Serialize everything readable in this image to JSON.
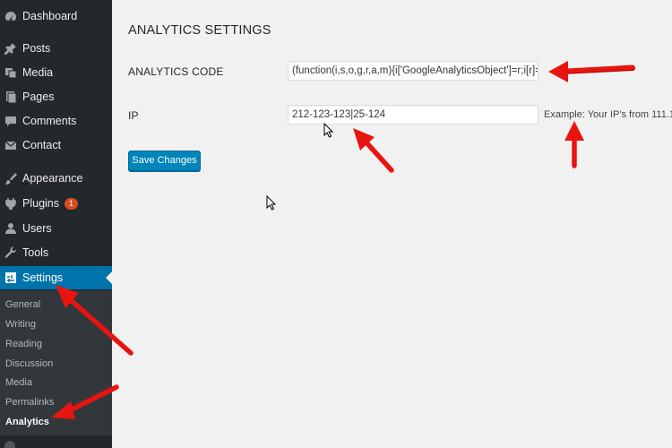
{
  "sidebar": {
    "items": [
      {
        "label": "Dashboard",
        "icon": "dashboard-icon"
      },
      {
        "label": "Posts",
        "icon": "pin-icon"
      },
      {
        "label": "Media",
        "icon": "media-icon"
      },
      {
        "label": "Pages",
        "icon": "pages-icon"
      },
      {
        "label": "Comments",
        "icon": "comment-icon"
      },
      {
        "label": "Contact",
        "icon": "mail-icon"
      },
      {
        "label": "Appearance",
        "icon": "brush-icon"
      },
      {
        "label": "Plugins",
        "icon": "plug-icon",
        "badge": "1"
      },
      {
        "label": "Users",
        "icon": "user-icon"
      },
      {
        "label": "Tools",
        "icon": "wrench-icon"
      },
      {
        "label": "Settings",
        "icon": "settings-icon"
      }
    ],
    "submenu": [
      "General",
      "Writing",
      "Reading",
      "Discussion",
      "Media",
      "Permalinks",
      "Analytics"
    ]
  },
  "main": {
    "title": "ANALYTICS SETTINGS",
    "analytics_code_label": "ANALYTICS CODE",
    "analytics_code_value": "(function(i,s,o,g,r,a,m){i['GoogleAnalyticsObject']=r;i[r]=",
    "ip_label": "IP",
    "ip_value": "212-123-123|25-124",
    "ip_example": "Example: Your IP's from 111.1",
    "save_label": "Save Changes"
  },
  "colors": {
    "sidebar_bg": "#23282d",
    "submenu_bg": "#32373c",
    "active_blue": "#0073aa",
    "button_blue": "#0085ba",
    "badge_orange": "#d54e21",
    "annotation_red": "#e8140f"
  }
}
